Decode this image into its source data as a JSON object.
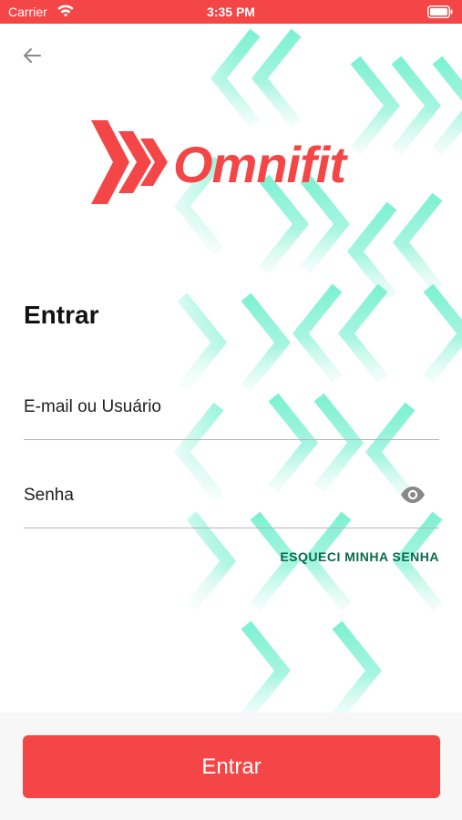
{
  "status_bar": {
    "carrier": "Carrier",
    "time": "3:35 PM"
  },
  "brand": {
    "name": "Omnifit",
    "primary_color": "#f44646",
    "pattern_color": "#77f0d0"
  },
  "page": {
    "title": "Entrar"
  },
  "form": {
    "email_placeholder": "E-mail ou Usuário",
    "password_placeholder": "Senha",
    "forgot_link": "ESQUECI MINHA SENHA",
    "submit_label": "Entrar"
  },
  "icons": {
    "back": "arrow-left-icon",
    "visibility": "eye-icon",
    "wifi": "wifi-icon",
    "battery": "battery-icon"
  }
}
